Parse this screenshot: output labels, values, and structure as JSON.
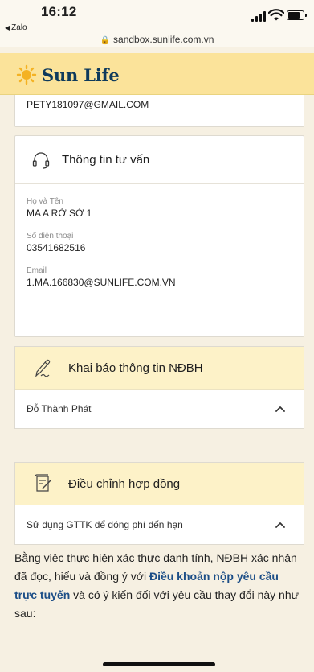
{
  "status_bar": {
    "time": "16:12",
    "back_app": "Zalo",
    "url": "sandbox.sunlife.com.vn"
  },
  "header": {
    "logo_text": "Sun Life",
    "brand_color": "#0e3a5c",
    "header_bg": "#fbe39a"
  },
  "owner_email_tail": "PETY181097@GMAIL.COM",
  "consultant": {
    "title": "Thông tin tư vấn",
    "fields": [
      {
        "label": "Họ và Tên",
        "value": "MA A RỜ SỞ 1"
      },
      {
        "label": "Số điện thoại",
        "value": "03541682516"
      },
      {
        "label": "Email",
        "value": "1.MA.166830@SUNLIFE.COM.VN"
      }
    ]
  },
  "insured_section": {
    "title": "Khai báo thông tin NĐBH",
    "row_label": "Đỗ Thành Phát",
    "icon": "pen-icon"
  },
  "contract_section": {
    "title": "Điều chỉnh hợp đồng",
    "row_label": "Sử dụng GTTK để đóng phí đến hạn",
    "icon": "document-edit-icon"
  },
  "consent": {
    "before": "Bằng việc thực hiện xác thực danh tính, NĐBH xác nhận đã đọc, hiểu và đồng ý với ",
    "link": "Điều khoản nộp yêu cầu trực tuyến",
    "after": " và có ý kiến đối với yêu cầu thay đổi này như sau:",
    "link_color": "#1c4e87"
  }
}
